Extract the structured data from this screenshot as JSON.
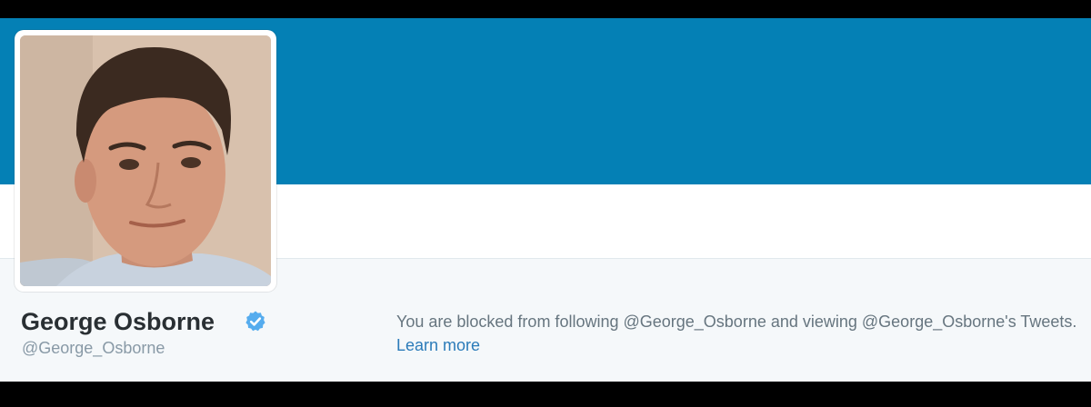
{
  "profile": {
    "display_name": "George Osborne",
    "screen_name": "@George_Osborne",
    "verified": true,
    "blocked_message": "You are blocked from following @George_Osborne and viewing @George_Osborne's Tweets.",
    "learn_more_label": "Learn more"
  },
  "colors": {
    "header_banner": "#0480b5",
    "verified_badge": "#55acee",
    "link": "#2b7bb9",
    "name_text": "#292f33",
    "muted_text": "#8899a6",
    "body_text": "#66757f",
    "page_background": "#f5f8fa"
  },
  "icons": {
    "verified": "verified-check-icon"
  }
}
